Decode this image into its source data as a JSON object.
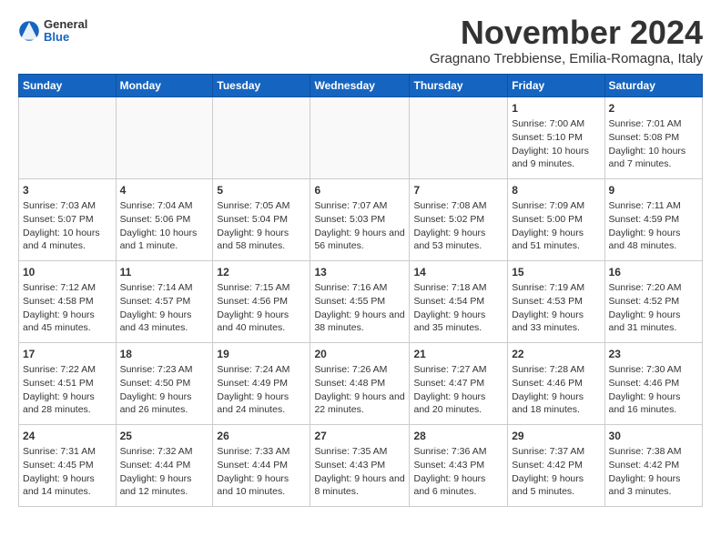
{
  "header": {
    "logo_general": "General",
    "logo_blue": "Blue",
    "month_title": "November 2024",
    "subtitle": "Gragnano Trebbiense, Emilia-Romagna, Italy"
  },
  "weekdays": [
    "Sunday",
    "Monday",
    "Tuesday",
    "Wednesday",
    "Thursday",
    "Friday",
    "Saturday"
  ],
  "weeks": [
    [
      {
        "day": "",
        "content": ""
      },
      {
        "day": "",
        "content": ""
      },
      {
        "day": "",
        "content": ""
      },
      {
        "day": "",
        "content": ""
      },
      {
        "day": "",
        "content": ""
      },
      {
        "day": "1",
        "content": "Sunrise: 7:00 AM\nSunset: 5:10 PM\nDaylight: 10 hours and 9 minutes."
      },
      {
        "day": "2",
        "content": "Sunrise: 7:01 AM\nSunset: 5:08 PM\nDaylight: 10 hours and 7 minutes."
      }
    ],
    [
      {
        "day": "3",
        "content": "Sunrise: 7:03 AM\nSunset: 5:07 PM\nDaylight: 10 hours and 4 minutes."
      },
      {
        "day": "4",
        "content": "Sunrise: 7:04 AM\nSunset: 5:06 PM\nDaylight: 10 hours and 1 minute."
      },
      {
        "day": "5",
        "content": "Sunrise: 7:05 AM\nSunset: 5:04 PM\nDaylight: 9 hours and 58 minutes."
      },
      {
        "day": "6",
        "content": "Sunrise: 7:07 AM\nSunset: 5:03 PM\nDaylight: 9 hours and 56 minutes."
      },
      {
        "day": "7",
        "content": "Sunrise: 7:08 AM\nSunset: 5:02 PM\nDaylight: 9 hours and 53 minutes."
      },
      {
        "day": "8",
        "content": "Sunrise: 7:09 AM\nSunset: 5:00 PM\nDaylight: 9 hours and 51 minutes."
      },
      {
        "day": "9",
        "content": "Sunrise: 7:11 AM\nSunset: 4:59 PM\nDaylight: 9 hours and 48 minutes."
      }
    ],
    [
      {
        "day": "10",
        "content": "Sunrise: 7:12 AM\nSunset: 4:58 PM\nDaylight: 9 hours and 45 minutes."
      },
      {
        "day": "11",
        "content": "Sunrise: 7:14 AM\nSunset: 4:57 PM\nDaylight: 9 hours and 43 minutes."
      },
      {
        "day": "12",
        "content": "Sunrise: 7:15 AM\nSunset: 4:56 PM\nDaylight: 9 hours and 40 minutes."
      },
      {
        "day": "13",
        "content": "Sunrise: 7:16 AM\nSunset: 4:55 PM\nDaylight: 9 hours and 38 minutes."
      },
      {
        "day": "14",
        "content": "Sunrise: 7:18 AM\nSunset: 4:54 PM\nDaylight: 9 hours and 35 minutes."
      },
      {
        "day": "15",
        "content": "Sunrise: 7:19 AM\nSunset: 4:53 PM\nDaylight: 9 hours and 33 minutes."
      },
      {
        "day": "16",
        "content": "Sunrise: 7:20 AM\nSunset: 4:52 PM\nDaylight: 9 hours and 31 minutes."
      }
    ],
    [
      {
        "day": "17",
        "content": "Sunrise: 7:22 AM\nSunset: 4:51 PM\nDaylight: 9 hours and 28 minutes."
      },
      {
        "day": "18",
        "content": "Sunrise: 7:23 AM\nSunset: 4:50 PM\nDaylight: 9 hours and 26 minutes."
      },
      {
        "day": "19",
        "content": "Sunrise: 7:24 AM\nSunset: 4:49 PM\nDaylight: 9 hours and 24 minutes."
      },
      {
        "day": "20",
        "content": "Sunrise: 7:26 AM\nSunset: 4:48 PM\nDaylight: 9 hours and 22 minutes."
      },
      {
        "day": "21",
        "content": "Sunrise: 7:27 AM\nSunset: 4:47 PM\nDaylight: 9 hours and 20 minutes."
      },
      {
        "day": "22",
        "content": "Sunrise: 7:28 AM\nSunset: 4:46 PM\nDaylight: 9 hours and 18 minutes."
      },
      {
        "day": "23",
        "content": "Sunrise: 7:30 AM\nSunset: 4:46 PM\nDaylight: 9 hours and 16 minutes."
      }
    ],
    [
      {
        "day": "24",
        "content": "Sunrise: 7:31 AM\nSunset: 4:45 PM\nDaylight: 9 hours and 14 minutes."
      },
      {
        "day": "25",
        "content": "Sunrise: 7:32 AM\nSunset: 4:44 PM\nDaylight: 9 hours and 12 minutes."
      },
      {
        "day": "26",
        "content": "Sunrise: 7:33 AM\nSunset: 4:44 PM\nDaylight: 9 hours and 10 minutes."
      },
      {
        "day": "27",
        "content": "Sunrise: 7:35 AM\nSunset: 4:43 PM\nDaylight: 9 hours and 8 minutes."
      },
      {
        "day": "28",
        "content": "Sunrise: 7:36 AM\nSunset: 4:43 PM\nDaylight: 9 hours and 6 minutes."
      },
      {
        "day": "29",
        "content": "Sunrise: 7:37 AM\nSunset: 4:42 PM\nDaylight: 9 hours and 5 minutes."
      },
      {
        "day": "30",
        "content": "Sunrise: 7:38 AM\nSunset: 4:42 PM\nDaylight: 9 hours and 3 minutes."
      }
    ]
  ]
}
